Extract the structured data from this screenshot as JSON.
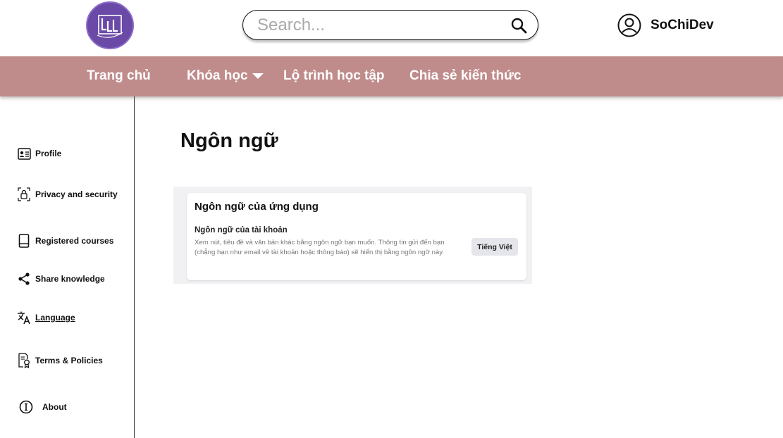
{
  "header": {
    "logo_icon": "brand-logo",
    "search": {
      "placeholder": "Search...",
      "value": "",
      "icon": "search-icon"
    },
    "user": {
      "name": "SoChiDev",
      "icon": "user-circle-icon"
    }
  },
  "nav": {
    "items": [
      {
        "label": "Trang chủ"
      },
      {
        "label": "Khóa học",
        "has_dropdown": true
      },
      {
        "label": "Lộ trình học tập"
      },
      {
        "label": "Chia sẻ kiến thức"
      }
    ]
  },
  "sidebar": {
    "items": [
      {
        "label": "Profile",
        "icon": "id-card-icon"
      },
      {
        "label": "Privacy and security",
        "icon": "lock-icon"
      },
      {
        "label": "Registered courses",
        "icon": "book-icon"
      },
      {
        "label": "Share knowledge",
        "icon": "share-icon"
      },
      {
        "label": "Language",
        "icon": "translate-icon",
        "active": true
      },
      {
        "label": "Terms & Policies",
        "icon": "document-badge-icon"
      },
      {
        "label": "About",
        "icon": "info-icon"
      }
    ]
  },
  "main": {
    "title": "Ngôn ngữ",
    "card": {
      "title": "Ngôn ngữ của ứng dụng",
      "setting_label": "Ngôn ngữ của tài khoản",
      "setting_description": "Xem nút, tiêu đề và văn bản khác bằng ngôn ngữ bạn muốn. Thông tin gửi đến bạn (chẳng hạn như email về tài khoản hoặc thông báo) sẽ hiển thị bằng ngôn ngữ này.",
      "current_language": "Tiếng Việt"
    }
  },
  "colors": {
    "nav_background": "#c08b8b",
    "logo_background": "#6a4aa6",
    "panel_background": "#f1f1f4",
    "language_button": "#e4e6eb"
  }
}
